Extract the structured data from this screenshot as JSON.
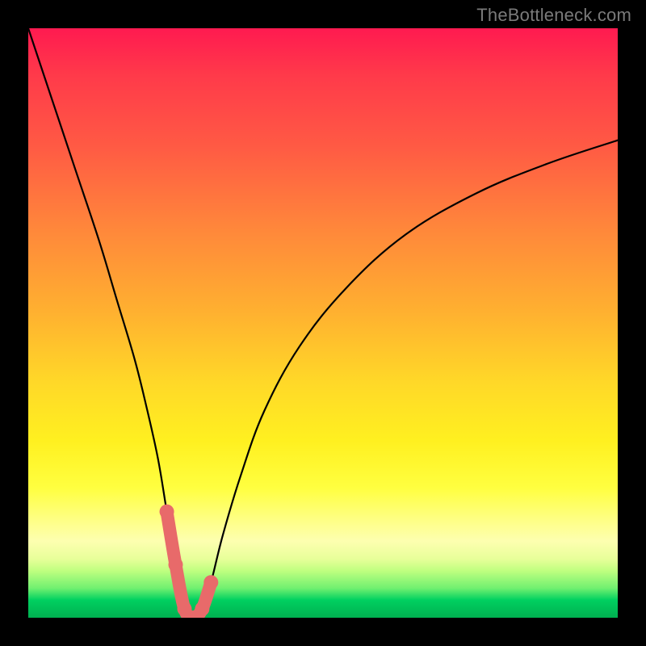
{
  "watermark": "TheBottleneck.com",
  "chart_data": {
    "type": "line",
    "title": "",
    "xlabel": "",
    "ylabel": "",
    "xlim": [
      0,
      100
    ],
    "ylim": [
      0,
      100
    ],
    "grid": false,
    "series": [
      {
        "name": "bottleneck-curve",
        "x": [
          0,
          4,
          8,
          12,
          15,
          18,
          20,
          22,
          23.5,
          25,
          26.5,
          28,
          29.5,
          31,
          33,
          36,
          40,
          46,
          54,
          64,
          76,
          88,
          100
        ],
        "values": [
          100,
          88,
          76,
          64,
          54,
          44,
          36,
          27,
          18,
          9,
          1.5,
          0,
          1.5,
          6,
          14,
          24,
          35,
          46,
          56,
          65,
          72,
          77,
          81
        ]
      }
    ],
    "annotations": [
      {
        "name": "valley-highlight",
        "type": "thick-segment",
        "color": "#e86a6a",
        "x": [
          23.5,
          25,
          26.5,
          28,
          29.5,
          31
        ],
        "values": [
          18,
          9,
          1.5,
          0,
          1.5,
          6
        ]
      }
    ]
  }
}
